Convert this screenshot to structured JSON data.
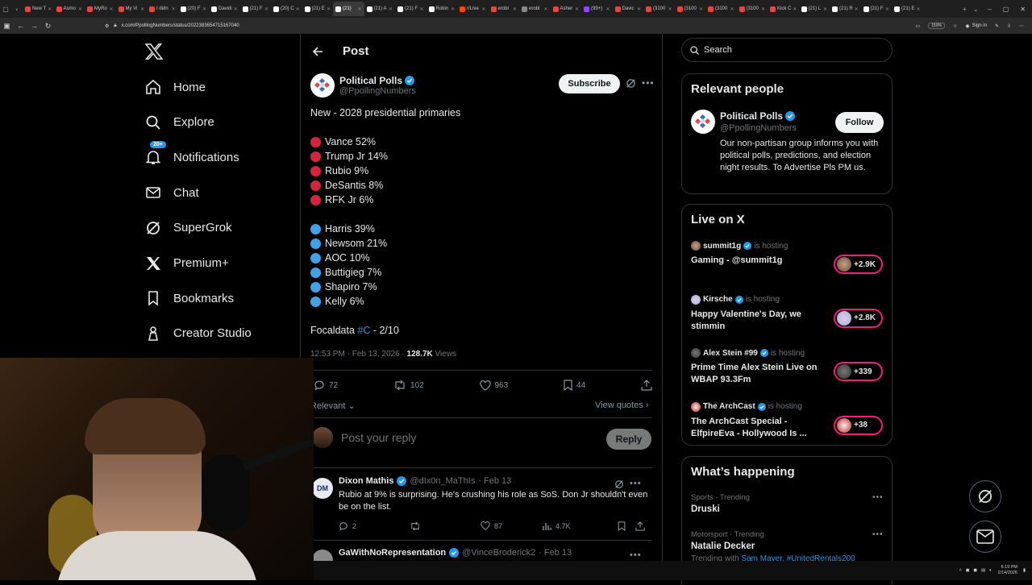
{
  "browser": {
    "tabs": [
      {
        "label": "New T",
        "color": "#e8453c"
      },
      {
        "label": "Asmo",
        "color": "#e8453c"
      },
      {
        "label": "MyRo",
        "color": "#e8453c"
      },
      {
        "label": "My Vi",
        "color": "#e8453c"
      },
      {
        "label": "I didn",
        "color": "#e8453c"
      },
      {
        "label": "(20) F",
        "color": "#ffffff"
      },
      {
        "label": "Davidi",
        "color": "#ffffff"
      },
      {
        "label": "(21) F",
        "color": "#ffffff"
      },
      {
        "label": "(20) C",
        "color": "#ffffff"
      },
      {
        "label": "(21) E",
        "color": "#ffffff"
      },
      {
        "label": "(21)",
        "color": "#ffffff",
        "active": true
      },
      {
        "label": "(21) A",
        "color": "#ffffff"
      },
      {
        "label": "(21) F",
        "color": "#ffffff"
      },
      {
        "label": "Robin",
        "color": "#ffffff"
      },
      {
        "label": "r/Live",
        "color": "#ff4500"
      },
      {
        "label": "erobl",
        "color": "#e8453c"
      },
      {
        "label": "erobl",
        "color": "#888888"
      },
      {
        "label": "Asher",
        "color": "#e8453c"
      },
      {
        "label": "(99+)",
        "color": "#9146ff"
      },
      {
        "label": "Davic",
        "color": "#e8453c"
      },
      {
        "label": "(3100",
        "color": "#e8453c"
      },
      {
        "label": "(3100",
        "color": "#e8453c"
      },
      {
        "label": "(3100",
        "color": "#e8453c"
      },
      {
        "label": "(3100",
        "color": "#e8453c"
      },
      {
        "label": "Kick C",
        "color": "#e8453c"
      },
      {
        "label": "(21) L",
        "color": "#ffffff"
      },
      {
        "label": "(21) R",
        "color": "#ffffff"
      },
      {
        "label": "(21) F",
        "color": "#ffffff"
      },
      {
        "label": "(21) E",
        "color": "#ffffff"
      }
    ],
    "url": "x.com/PpollingNumbers/status/2022383654715167040",
    "zoom": "150%",
    "sign_in": "Sign in"
  },
  "nav": {
    "items": [
      {
        "label": "Home",
        "icon": "home-icon"
      },
      {
        "label": "Explore",
        "icon": "search-icon"
      },
      {
        "label": "Notifications",
        "icon": "bell-icon",
        "badge": "20+"
      },
      {
        "label": "Chat",
        "icon": "mail-icon"
      },
      {
        "label": "SuperGrok",
        "icon": "grok-icon"
      },
      {
        "label": "Premium+",
        "icon": "x-icon"
      },
      {
        "label": "Bookmarks",
        "icon": "bookmark-icon"
      },
      {
        "label": "Creator Studio",
        "icon": "creator-icon"
      }
    ]
  },
  "post": {
    "header_title": "Post",
    "author_name": "Political Polls",
    "author_handle": "@PpollingNumbers",
    "subscribe_label": "Subscribe",
    "intro": "New - 2028 presidential primaries",
    "republicans": [
      "Vance 52%",
      "Trump Jr 14%",
      "Rubio 9%",
      "DeSantis 8%",
      "RFK Jr 6%"
    ],
    "democrats": [
      "Harris 39%",
      "Newsom 21%",
      "AOC 10%",
      "Buttigieg 7%",
      "Shapiro 7%",
      "Kelly 6%"
    ],
    "source_prefix": "Focaldata ",
    "source_tag": "#C",
    "source_suffix": " - 2/10",
    "time": "12:53 PM · Feb 13, 2026 · ",
    "views_count": "128.7K",
    "views_label": " Views",
    "stats": {
      "replies": "72",
      "reposts": "102",
      "likes": "963",
      "bookmarks": "44"
    },
    "sort_label": "Relevant",
    "view_quotes": "View quotes",
    "reply_placeholder": "Post your reply",
    "reply_button": "Reply"
  },
  "replies": [
    {
      "avatar": "DM",
      "name": "Dixon Mathis",
      "handle": "@dIx0n_MaThIs",
      "date": "· Feb 13",
      "text": "Rubio at 9% is surprising.  He's crushing his role as SoS.  Don Jr shouldn't even be on the list.",
      "replies": "2",
      "likes": "87",
      "views": "4.7K"
    },
    {
      "name": "GaWithNoRepresentation",
      "handle": "@VinceBroderick2",
      "date": "· Feb 13"
    }
  ],
  "right": {
    "search_placeholder": "Search",
    "relevant_title": "Relevant people",
    "person": {
      "name": "Political Polls",
      "handle": "@PpollingNumbers",
      "follow": "Follow",
      "bio": "Our non-partisan group informs you with political polls, predictions, and election night results. To Advertise Pls PM us."
    },
    "live_title": "Live on X",
    "live": [
      {
        "host": "summit1g",
        "is_hosting": "is hosting",
        "title": "Gaming - @summit1g",
        "count": "+2.9K"
      },
      {
        "host": "Kirsche",
        "is_hosting": "is hosting",
        "title": "Happy Valentine's Day, we stimmin",
        "count": "+2.8K"
      },
      {
        "host": "Alex Stein #99",
        "is_hosting": "is hosting",
        "title": "Prime Time Alex Stein Live on WBAP 93.3Fm",
        "count": "+339"
      },
      {
        "host": "The ArchCast",
        "is_hosting": "is hosting",
        "title": "The ArchCast Special - ElfpireEva - Hollywood Is ...",
        "count": "+38"
      }
    ],
    "happening_title": "What’s happening",
    "trends": [
      {
        "category": "Sports · Trending",
        "name": "Druski"
      },
      {
        "category": "Motorsport · Trending",
        "name": "Natalie Decker",
        "sub_prefix": "Trending with ",
        "sub_tags": "Sam Mayer, #UnitedRentals200"
      }
    ]
  },
  "taskbar": {
    "time": "6:19 PM",
    "date": "2/14/2026"
  },
  "colors": {
    "accent": "#1d9bf0",
    "republican": "#d9233b",
    "democrat": "#3fa3ea",
    "live": "#f91880"
  }
}
